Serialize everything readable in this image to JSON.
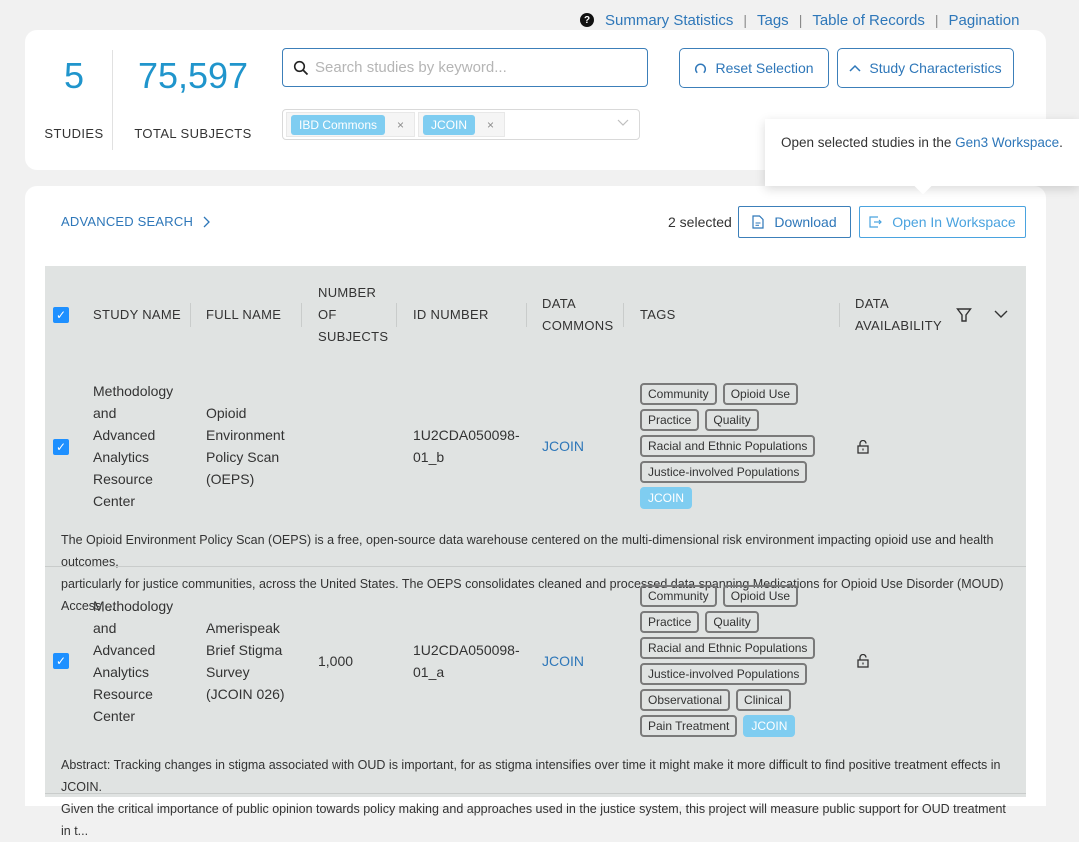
{
  "topnav": {
    "help_icon": "question-circle-icon",
    "links": [
      "Summary Statistics",
      "Tags",
      "Table of Records",
      "Pagination"
    ],
    "separator": "|"
  },
  "stats": {
    "studies_value": "5",
    "studies_label": "STUDIES",
    "subjects_value": "75,597",
    "subjects_label": "TOTAL SUBJECTS"
  },
  "search": {
    "placeholder": "Search studies by keyword...",
    "value": ""
  },
  "commons_filter": {
    "selected": [
      "IBD Commons",
      "JCOIN"
    ],
    "remove_glyph": "×"
  },
  "buttons": {
    "reset_selection": "Reset Selection",
    "study_characteristics": "Study Characteristics",
    "download": "Download",
    "open_in_workspace": "Open In Workspace"
  },
  "advanced_search": "ADVANCED SEARCH",
  "selected_count": "2 selected",
  "tooltip": {
    "text_before": "Open selected studies in the ",
    "link_text": "Gen3 Workspace",
    "text_after": "."
  },
  "table": {
    "headers": {
      "study_name": "STUDY NAME",
      "full_name": "FULL NAME",
      "num_subjects_1": "NUMBER",
      "num_subjects_2": "OF",
      "num_subjects_3": "SUBJECTS",
      "id_number": "ID NUMBER",
      "data_commons_1": "DATA",
      "data_commons_2": "COMMONS",
      "tags": "TAGS",
      "data_avail_1": "DATA",
      "data_avail_2": "AVAILABILITY"
    },
    "rows": [
      {
        "checked": true,
        "study_name": [
          "Methodology",
          "and",
          "Advanced",
          "Analytics",
          "Resource",
          "Center"
        ],
        "full_name": [
          "Opioid",
          "Environment",
          "Policy Scan",
          "(OEPS)"
        ],
        "num_subjects": "",
        "id_number": [
          "1U2CDA050098-",
          "01_b"
        ],
        "data_commons": "JCOIN",
        "tags": [
          "Community",
          "Opioid Use",
          "Practice",
          "Quality",
          "Racial and Ethnic Populations",
          "Justice-involved Populations"
        ],
        "commons_tag": "JCOIN",
        "availability_icon": "unlock-icon",
        "abstract": [
          "The Opioid Environment Policy Scan (OEPS) is a free, open-source data warehouse centered on the multi-dimensional risk environment impacting opioid use and health outcomes,",
          "particularly for justice communities, across the United States. The OEPS consolidates cleaned and processed data spanning Medications for Opioid Use Disorder (MOUD) Access,..."
        ]
      },
      {
        "checked": true,
        "study_name": [
          "Methodology",
          "and",
          "Advanced",
          "Analytics",
          "Resource",
          "Center"
        ],
        "full_name": [
          "Amerispeak",
          "Brief Stigma",
          "Survey",
          "(JCOIN 026)"
        ],
        "num_subjects": "1,000",
        "id_number": [
          "1U2CDA050098-",
          "01_a"
        ],
        "data_commons": "JCOIN",
        "tags": [
          "Community",
          "Opioid Use",
          "Practice",
          "Quality",
          "Racial and Ethnic Populations",
          "Justice-involved Populations",
          "Observational",
          "Clinical",
          "Pain Treatment"
        ],
        "commons_tag": "JCOIN",
        "availability_icon": "unlock-icon",
        "abstract": [
          "Abstract: Tracking changes in stigma associated with OUD is important, for as stigma intensifies over time it might make it more difficult to find positive treatment effects in JCOIN.",
          "Given the critical importance of public opinion towards policy making and approaches used in the justice system, this project will measure public support for OUD treatment in t..."
        ]
      }
    ]
  }
}
